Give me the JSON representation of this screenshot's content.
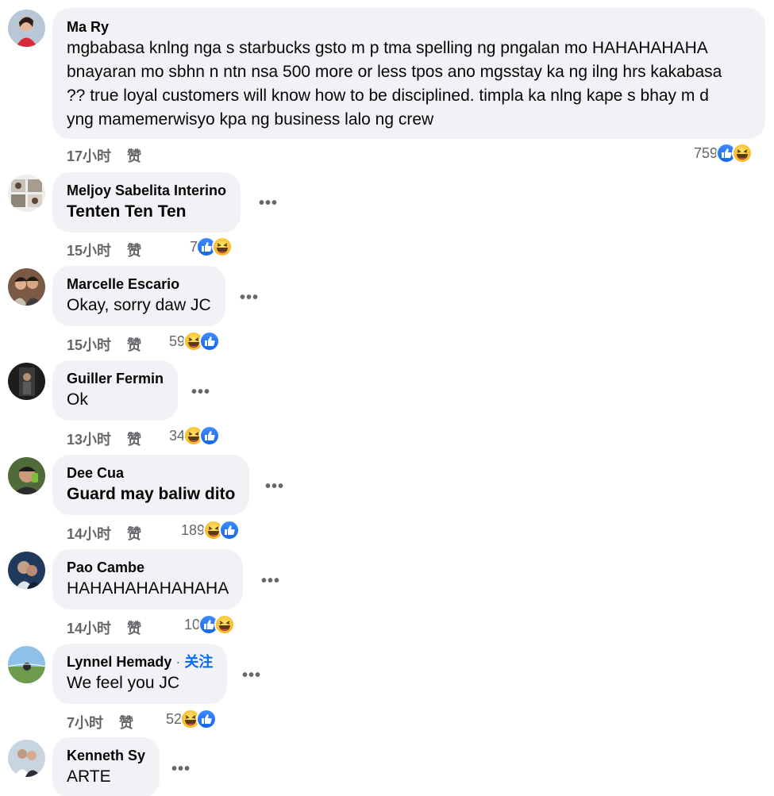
{
  "comments": [
    {
      "author": "Ma Ry",
      "lines": [
        "mgbabasa knlng nga s starbucks gsto m p tma spelling ng pngalan mo HAHAHAHAHA",
        "bnayaran mo sbhn n ntn nsa 500 more or less tpos ano mgsstay ka ng ilng hrs kakabasa",
        "?? true loyal customers will know how to be disciplined. timpla ka nlng kape s bhay m d",
        "yng mamemerwisyo kpa ng business lalo ng crew"
      ],
      "time": "17小时",
      "like_label": "赞",
      "reaction_count": "759",
      "reactions": [
        "like-icon",
        "haha-icon"
      ]
    },
    {
      "author": "Meljoy Sabelita Interino",
      "text": "Tenten Ten Ten",
      "time": "15小时",
      "like_label": "赞",
      "reaction_count": "7",
      "reactions": [
        "like-icon",
        "haha-icon"
      ]
    },
    {
      "author": "Marcelle Escario",
      "text": "Okay, sorry daw JC",
      "time": "15小时",
      "like_label": "赞",
      "reaction_count": "59",
      "reactions": [
        "haha-icon",
        "like-icon"
      ]
    },
    {
      "author": "Guiller Fermin",
      "text": "Ok",
      "time": "13小时",
      "like_label": "赞",
      "reaction_count": "34",
      "reactions": [
        "haha-icon",
        "like-icon"
      ]
    },
    {
      "author": "Dee Cua",
      "text": "Guard may baliw dito",
      "time": "14小时",
      "like_label": "赞",
      "reaction_count": "189",
      "reactions": [
        "haha-icon",
        "like-icon"
      ]
    },
    {
      "author": "Pao Cambe",
      "text": "HAHAHAHAHAHAHA",
      "time": "14小时",
      "like_label": "赞",
      "reaction_count": "10",
      "reactions": [
        "like-icon",
        "haha-icon"
      ]
    },
    {
      "author": "Lynnel Hemady",
      "follow_label": "关注",
      "separator": " · ",
      "text": "We feel you JC",
      "time": "7小时",
      "like_label": "赞",
      "reaction_count": "52",
      "reactions": [
        "haha-icon",
        "like-icon"
      ]
    },
    {
      "author": "Kenneth Sy",
      "text": "ARTE"
    }
  ],
  "more_label": "•••",
  "colors": {
    "bubble": "#f0f2f5",
    "meta_text": "#65676b",
    "like_blue": "#1877f2",
    "haha_yellow": "#f7b928",
    "follow_blue": "#0866ff"
  }
}
